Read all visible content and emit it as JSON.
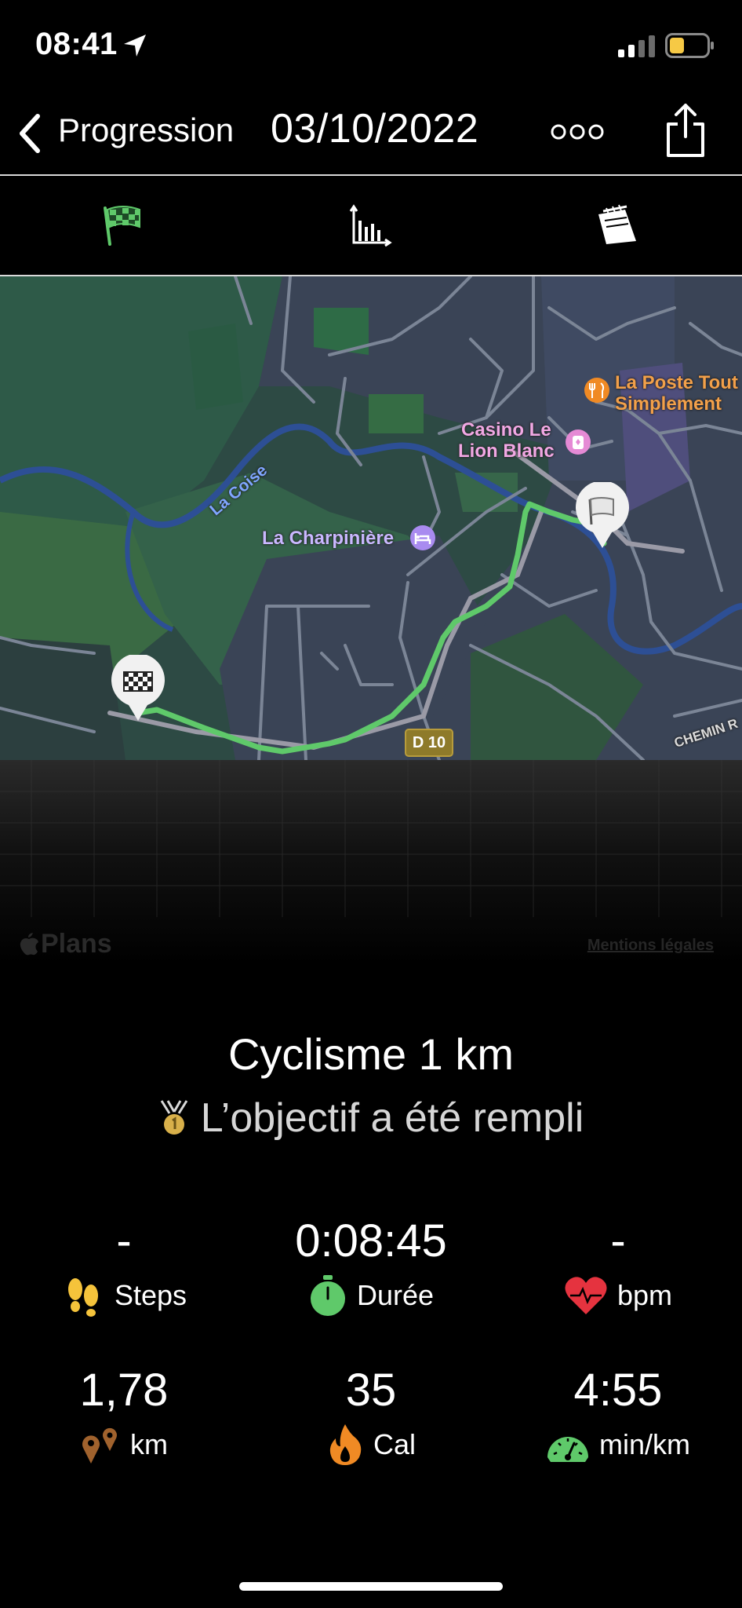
{
  "status_bar": {
    "time": "08:41"
  },
  "nav": {
    "back_label": "Progression",
    "title": "03/10/2022"
  },
  "tabs": [
    {
      "name": "finish-flag"
    },
    {
      "name": "bar-chart"
    },
    {
      "name": "notes"
    }
  ],
  "map": {
    "labels": {
      "la_poste": "La Poste Tout\nSimplement",
      "casino": "Casino Le\nLion Blanc",
      "charpiniere": "La Charpinière",
      "la_coise": "La Coise",
      "d10": "D 10",
      "chemin": "CHEMIN R"
    },
    "attribution": "Plans",
    "legal": "Mentions légales",
    "route_color": "#5fc96a"
  },
  "summary": {
    "title": "Cyclisme 1 km",
    "goal": "L’objectif a été rempli"
  },
  "stats": {
    "steps": {
      "value": "-",
      "label": "Steps"
    },
    "duration": {
      "value": "0:08:45",
      "label": "Durée"
    },
    "heart": {
      "value": "-",
      "label": "bpm"
    },
    "distance": {
      "value": "1,78",
      "label": "km"
    },
    "calories": {
      "value": "35",
      "label": "Cal"
    },
    "pace": {
      "value": "4:55",
      "label": "min/km"
    }
  },
  "colors": {
    "accent_green": "#5fc96a",
    "heart_red": "#e5333f",
    "flame_orange": "#f08a24",
    "steps_yellow": "#f5c33b",
    "pin_brown": "#a0622d"
  }
}
